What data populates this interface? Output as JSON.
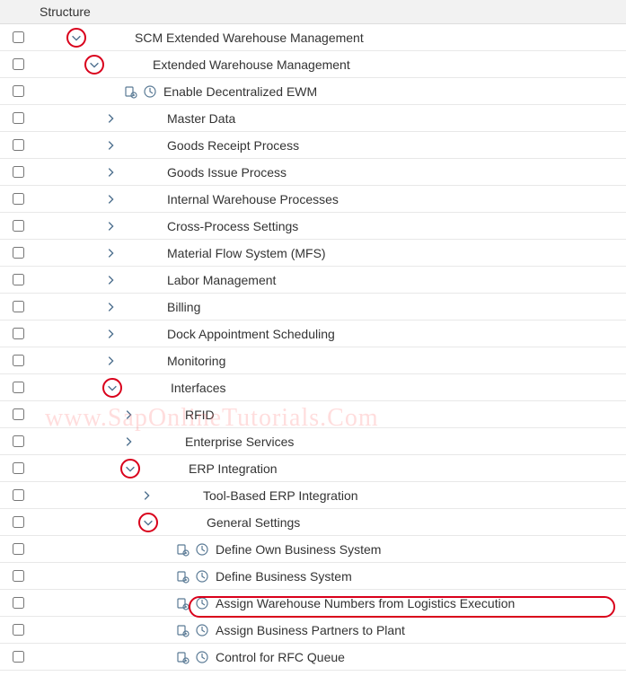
{
  "header": {
    "title": "Structure"
  },
  "watermark": "www.SapOnlineTutorials.Com",
  "rows": [
    {
      "indent": 38,
      "toggle": "down",
      "circled": true,
      "icons": "",
      "label": "SCM Extended Warehouse Management"
    },
    {
      "indent": 58,
      "toggle": "down",
      "circled": true,
      "icons": "",
      "label": "Extended Warehouse Management"
    },
    {
      "indent": 100,
      "toggle": "",
      "circled": false,
      "icons": "pair",
      "label": "Enable Decentralized EWM"
    },
    {
      "indent": 78,
      "toggle": "right",
      "circled": false,
      "icons": "",
      "label": "Master Data"
    },
    {
      "indent": 78,
      "toggle": "right",
      "circled": false,
      "icons": "",
      "label": "Goods Receipt Process"
    },
    {
      "indent": 78,
      "toggle": "right",
      "circled": false,
      "icons": "",
      "label": "Goods Issue Process"
    },
    {
      "indent": 78,
      "toggle": "right",
      "circled": false,
      "icons": "",
      "label": "Internal Warehouse Processes"
    },
    {
      "indent": 78,
      "toggle": "right",
      "circled": false,
      "icons": "",
      "label": "Cross-Process Settings"
    },
    {
      "indent": 78,
      "toggle": "right",
      "circled": false,
      "icons": "",
      "label": "Material Flow System (MFS)"
    },
    {
      "indent": 78,
      "toggle": "right",
      "circled": false,
      "icons": "",
      "label": "Labor Management"
    },
    {
      "indent": 78,
      "toggle": "right",
      "circled": false,
      "icons": "",
      "label": "Billing"
    },
    {
      "indent": 78,
      "toggle": "right",
      "circled": false,
      "icons": "",
      "label": "Dock Appointment Scheduling"
    },
    {
      "indent": 78,
      "toggle": "right",
      "circled": false,
      "icons": "",
      "label": "Monitoring"
    },
    {
      "indent": 78,
      "toggle": "down",
      "circled": true,
      "icons": "",
      "label": "Interfaces"
    },
    {
      "indent": 98,
      "toggle": "right",
      "circled": false,
      "icons": "",
      "label": "RFID"
    },
    {
      "indent": 98,
      "toggle": "right",
      "circled": false,
      "icons": "",
      "label": "Enterprise Services"
    },
    {
      "indent": 98,
      "toggle": "down",
      "circled": true,
      "icons": "",
      "label": "ERP Integration"
    },
    {
      "indent": 118,
      "toggle": "right",
      "circled": false,
      "icons": "",
      "label": "Tool-Based ERP Integration"
    },
    {
      "indent": 118,
      "toggle": "down",
      "circled": true,
      "icons": "",
      "label": "General Settings"
    },
    {
      "indent": 158,
      "toggle": "",
      "circled": false,
      "icons": "pair",
      "label": "Define Own Business System"
    },
    {
      "indent": 158,
      "toggle": "",
      "circled": false,
      "icons": "pair",
      "label": "Define Business System"
    },
    {
      "indent": 158,
      "toggle": "",
      "circled": false,
      "icons": "pair",
      "label": "Assign Warehouse Numbers from Logistics Execution"
    },
    {
      "indent": 158,
      "toggle": "",
      "circled": false,
      "icons": "pair",
      "label": "Assign Business Partners to Plant"
    },
    {
      "indent": 158,
      "toggle": "",
      "circled": false,
      "icons": "pair",
      "label": "Control for RFC Queue"
    }
  ]
}
